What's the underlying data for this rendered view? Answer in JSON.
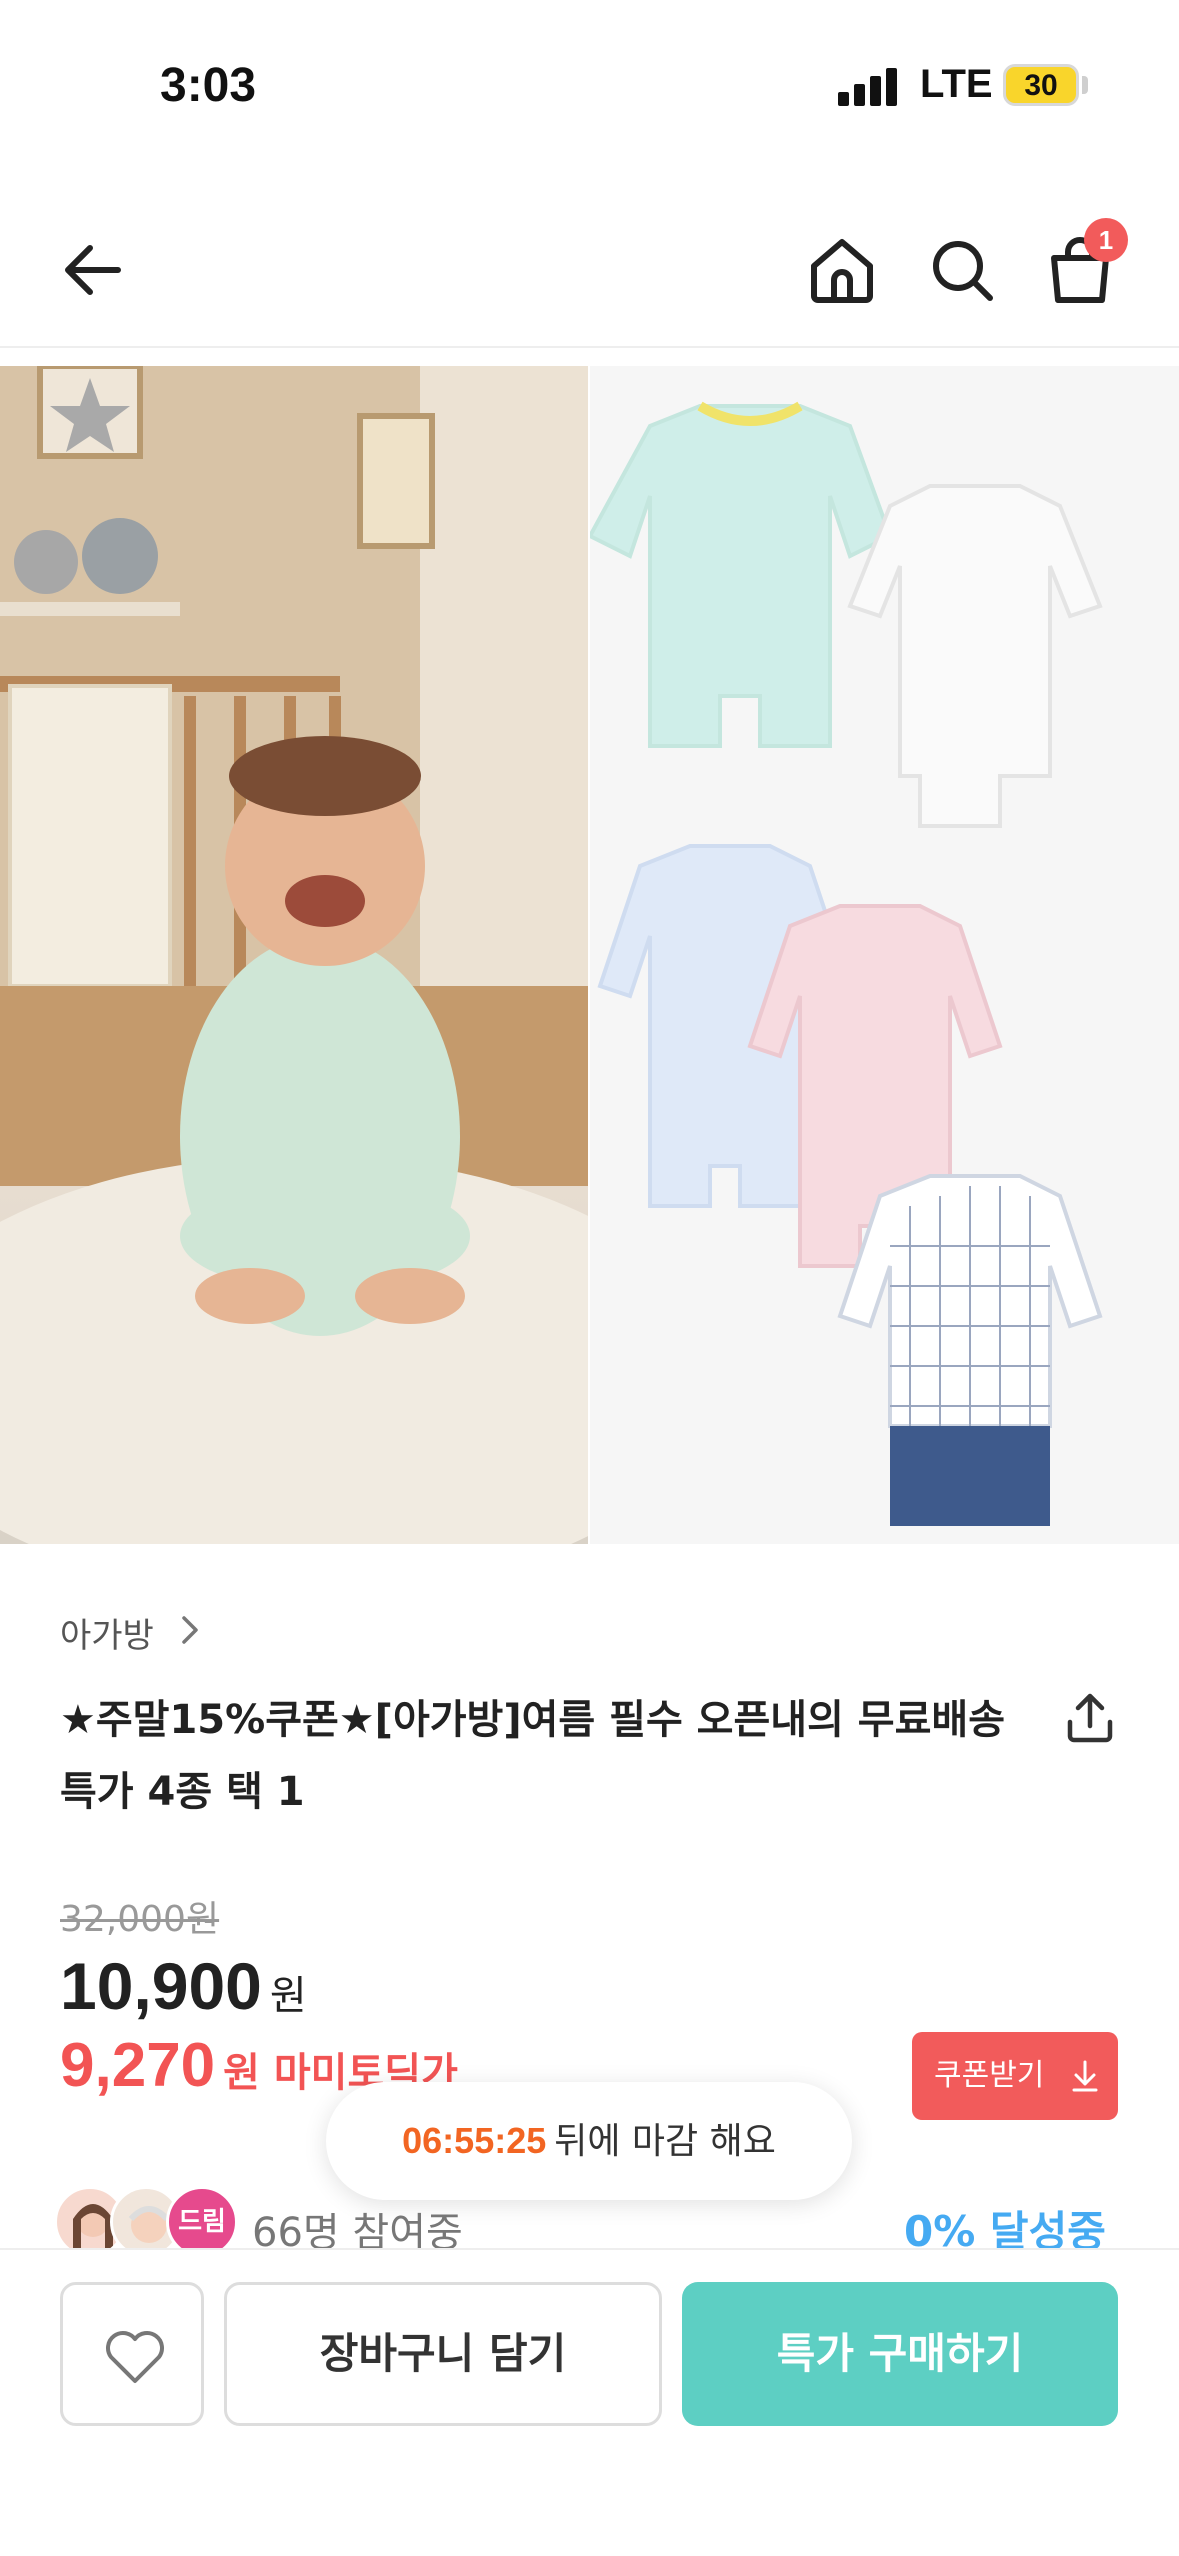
{
  "status_bar": {
    "time": "3:03",
    "network": "LTE",
    "battery": "30",
    "battery_color": "#f9d52b"
  },
  "header": {
    "back_icon": "arrow-left-icon",
    "home_icon": "home-icon",
    "search_icon": "search-icon",
    "cart_icon": "shopping-bag-icon",
    "cart_badge": "1",
    "badge_color": "#f25b5b"
  },
  "hero": {
    "left_image": "baby-sitting-on-rug-photo",
    "right_image": "baby-clothes-collage-photo"
  },
  "product": {
    "brand": "아가방",
    "title": "★주말15%쿠폰★[아가방]여름 필수 오픈내의 무료배송 특가 4종 택 1",
    "share_icon": "share-icon",
    "original_price": "32,000원",
    "sale_price": "10,900",
    "sale_unit": "원",
    "member_price": "9,270",
    "member_label": "원 마미토딕가",
    "member_color": "#f25454",
    "coupon_button": "쿠폰받기",
    "coupon_icon": "download-arrow-icon"
  },
  "timer": {
    "value": "06:55:25",
    "suffix": "뒤에 마감 해요",
    "value_color": "#f26522"
  },
  "participants": {
    "avatar_badge": "드림",
    "count_text": "66명 참여중",
    "achievement": "0% 달성중",
    "achievement_color": "#45aaf2"
  },
  "bottom_bar": {
    "wish_icon": "heart-icon",
    "cart_add_label": "장바구니 담기",
    "buy_label": "특가 구매하기",
    "buy_color": "#5dcfc3"
  }
}
